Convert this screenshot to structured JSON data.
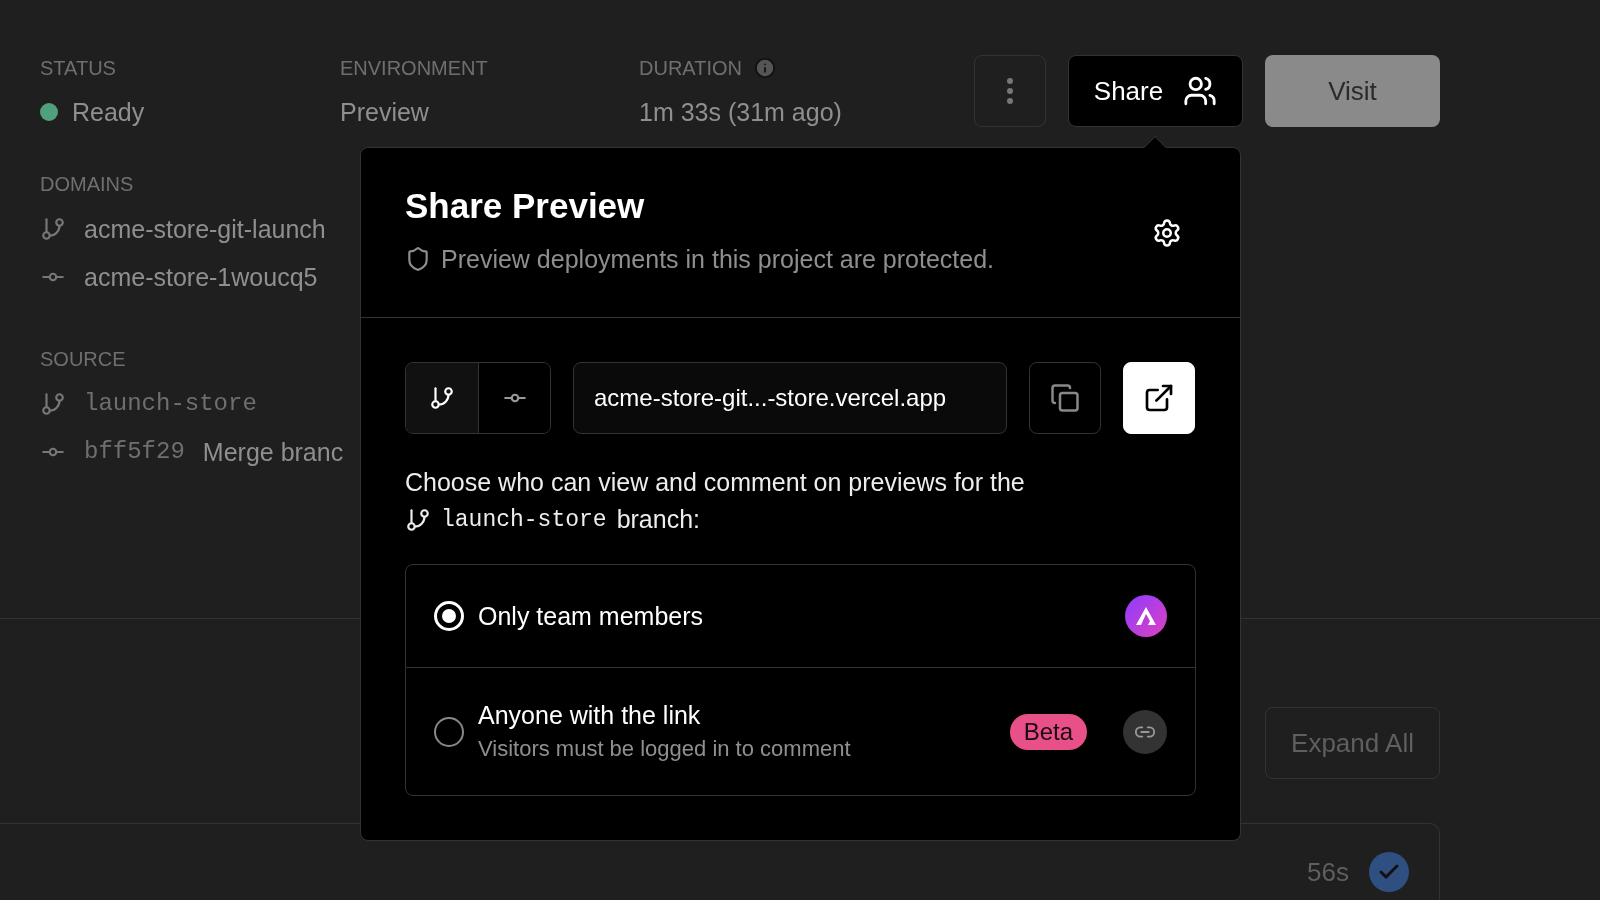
{
  "summary": [
    {
      "kind": "status",
      "label": "STATUS",
      "value": "Ready"
    },
    {
      "kind": "plain",
      "label": "ENVIRONMENT",
      "value": "Preview"
    },
    {
      "kind": "info",
      "label": "DURATION",
      "value": "1m 33s (31m ago)"
    }
  ],
  "actions": {
    "share": "Share",
    "visit": "Visit"
  },
  "domains": {
    "title": "DOMAINS",
    "items": [
      {
        "kind": "branch",
        "text": "acme-store-git-launch"
      },
      {
        "kind": "commit",
        "text": "acme-store-1woucq5"
      }
    ]
  },
  "source": {
    "title": "SOURCE",
    "items": [
      {
        "kind": "branch",
        "code": "launch-store"
      },
      {
        "kind": "commit",
        "code": "bff5f29",
        "text": "Merge branc"
      }
    ]
  },
  "expand_button": "Expand All",
  "bottom_card": {
    "duration": "56s"
  },
  "share_popover": {
    "title": "Share Preview",
    "subtitle": "Preview deployments in this project are protected.",
    "mode_buttons": [
      {
        "kind": "branch",
        "selected": true
      },
      {
        "kind": "commit",
        "selected": false
      }
    ],
    "url": "acme-store-git...-store.vercel.app",
    "description": "Choose who can view and comment on previews for the",
    "branch": "launch-store",
    "description_end": "branch:",
    "options": [
      {
        "kind": "team",
        "label": "Only team members",
        "selected": true
      },
      {
        "kind": "link",
        "label": "Anyone with the link",
        "hint": "Visitors must be logged in to comment",
        "badge": "Beta",
        "selected": false
      }
    ]
  }
}
